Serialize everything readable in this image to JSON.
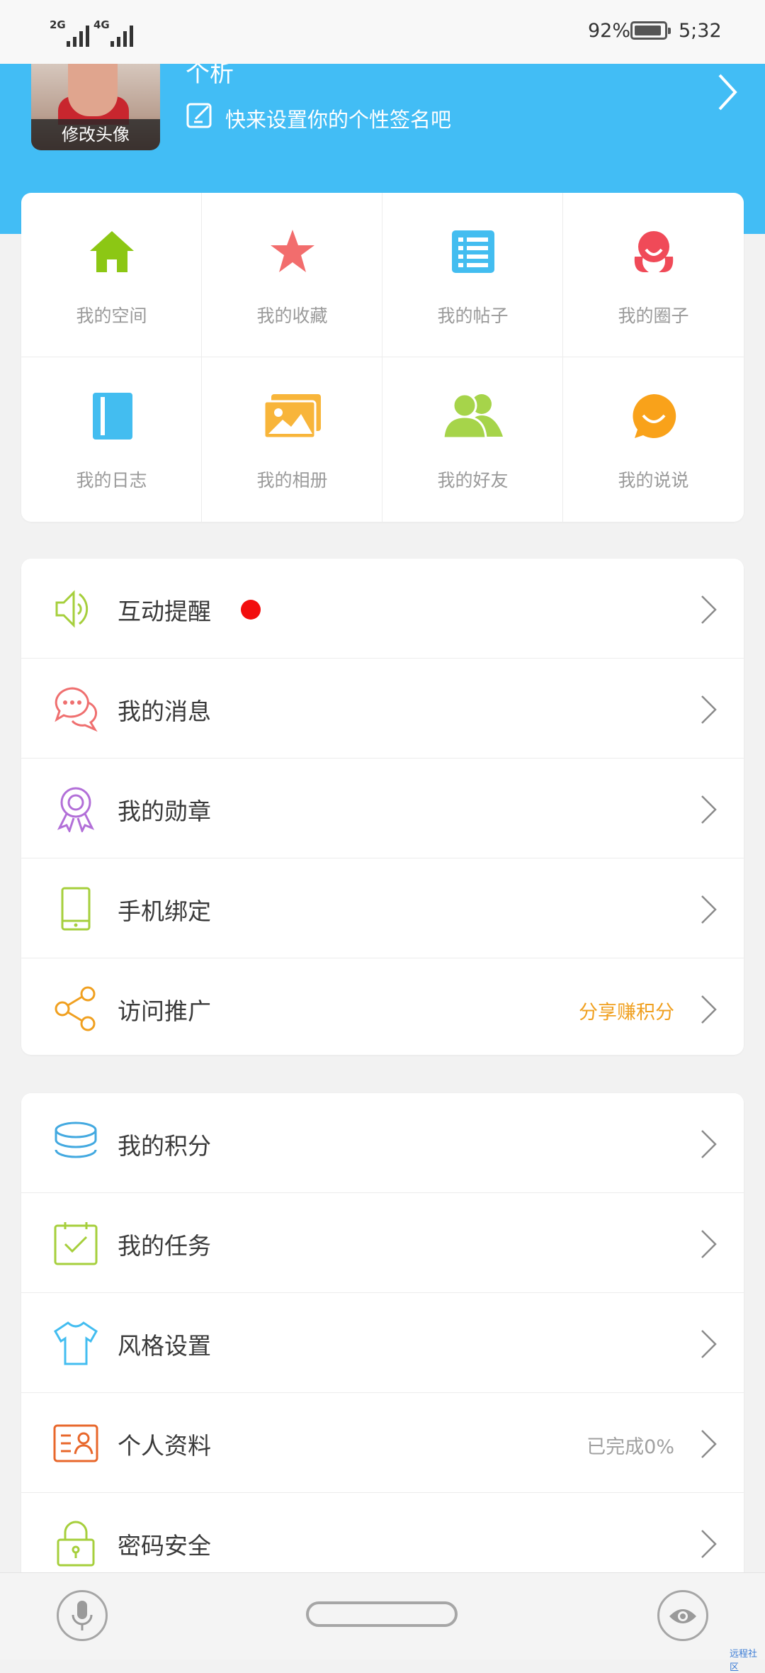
{
  "status_bar": {
    "signal_1": "2G",
    "signal_2": "4G",
    "battery": "92%",
    "time": "5;32"
  },
  "profile": {
    "username_fragment": "个析",
    "avatar_label": "修改头像",
    "signature_prompt": "快来设置你的个性签名吧"
  },
  "grid": [
    {
      "label": "我的空间",
      "icon": "home-icon",
      "color": "#8cc714"
    },
    {
      "label": "我的收藏",
      "icon": "star-icon",
      "color": "#f26d6d"
    },
    {
      "label": "我的帖子",
      "icon": "list-icon",
      "color": "#43bdf0"
    },
    {
      "label": "我的圈子",
      "icon": "circle-group-icon",
      "color": "#f04a58"
    },
    {
      "label": "我的日志",
      "icon": "notebook-icon",
      "color": "#43bdf0"
    },
    {
      "label": "我的相册",
      "icon": "photo-album-icon",
      "color": "#f8b53a"
    },
    {
      "label": "我的好友",
      "icon": "friends-icon",
      "color": "#a6d44a"
    },
    {
      "label": "我的说说",
      "icon": "chat-bubble-icon",
      "color": "#f9a21a"
    }
  ],
  "list1": [
    {
      "label": "互动提醒",
      "icon": "speaker-icon",
      "has_dot": true
    },
    {
      "label": "我的消息",
      "icon": "message-icon"
    },
    {
      "label": "我的勋章",
      "icon": "medal-icon"
    },
    {
      "label": "手机绑定",
      "icon": "phone-icon"
    },
    {
      "label": "访问推广",
      "icon": "share-icon",
      "sub": "分享赚积分",
      "sub_color": "#f0a020"
    }
  ],
  "list2": [
    {
      "label": "我的积分",
      "icon": "coins-icon"
    },
    {
      "label": "我的任务",
      "icon": "task-icon"
    },
    {
      "label": "风格设置",
      "icon": "tshirt-icon"
    },
    {
      "label": "个人资料",
      "icon": "profile-card-icon",
      "sub": "已完成0%",
      "sub_color": "#a0a0a0"
    },
    {
      "label": "密码安全",
      "icon": "lock-icon"
    }
  ],
  "watermark": "远程社区"
}
